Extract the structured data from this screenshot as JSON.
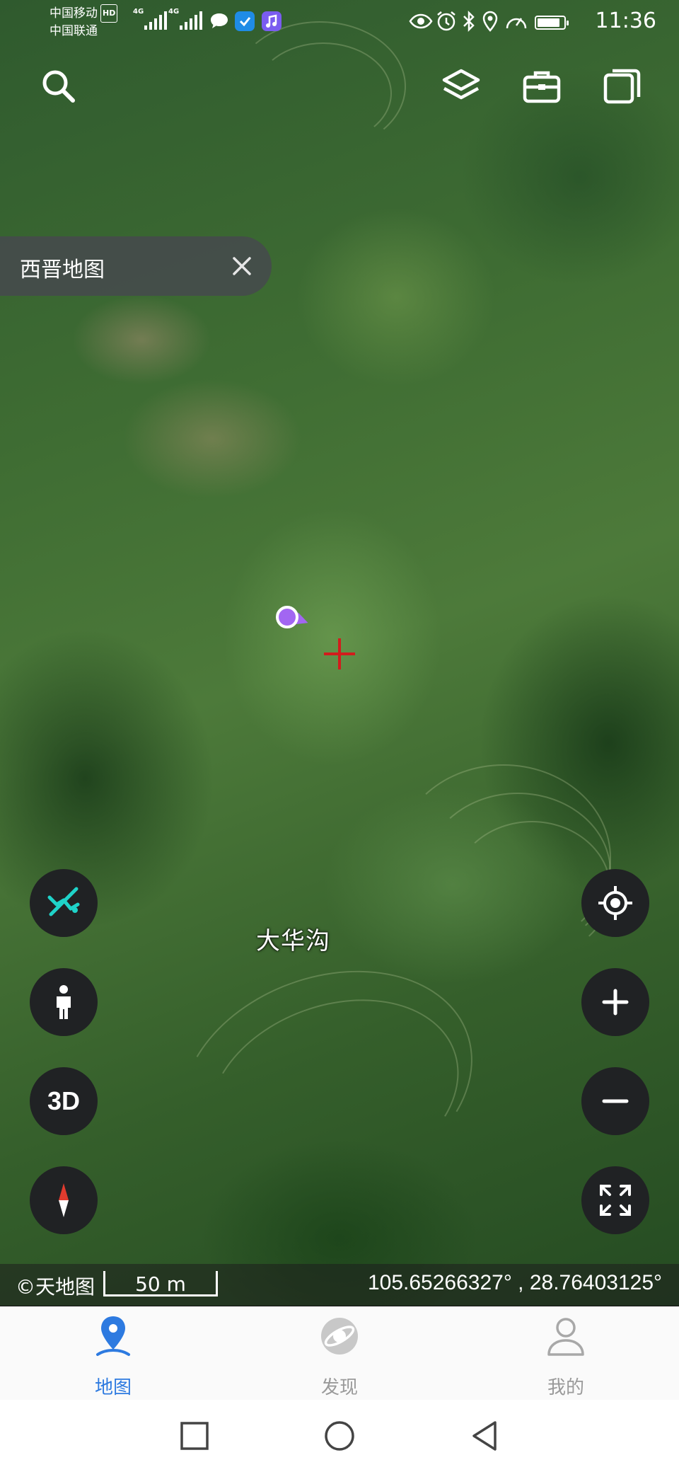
{
  "status_bar": {
    "carrier_primary": "中国移动",
    "carrier_secondary": "中国联通",
    "hd_badge": "HD",
    "signal_1_label": "4G",
    "signal_2_label": "4G",
    "battery_level": 0.85,
    "time": "11:36"
  },
  "search_chip": {
    "text": "西晋地图"
  },
  "map": {
    "place_label": "大华沟",
    "copyright": "©天地图",
    "scale_label": "50 m",
    "coordinates": "105.65266327° , 28.76403125°"
  },
  "left_controls": {
    "three_d_label": "3D"
  },
  "bottom_nav": {
    "tabs": [
      {
        "label": "地图",
        "active": true
      },
      {
        "label": "发现",
        "active": false
      },
      {
        "label": "我的",
        "active": false
      }
    ]
  },
  "colors": {
    "accent_blue": "#2d7ae0",
    "control_bg": "#202224",
    "crosshair_red": "#d21c1c",
    "location_purple": "#a266f2",
    "track_cyan": "#1fd3c9"
  }
}
